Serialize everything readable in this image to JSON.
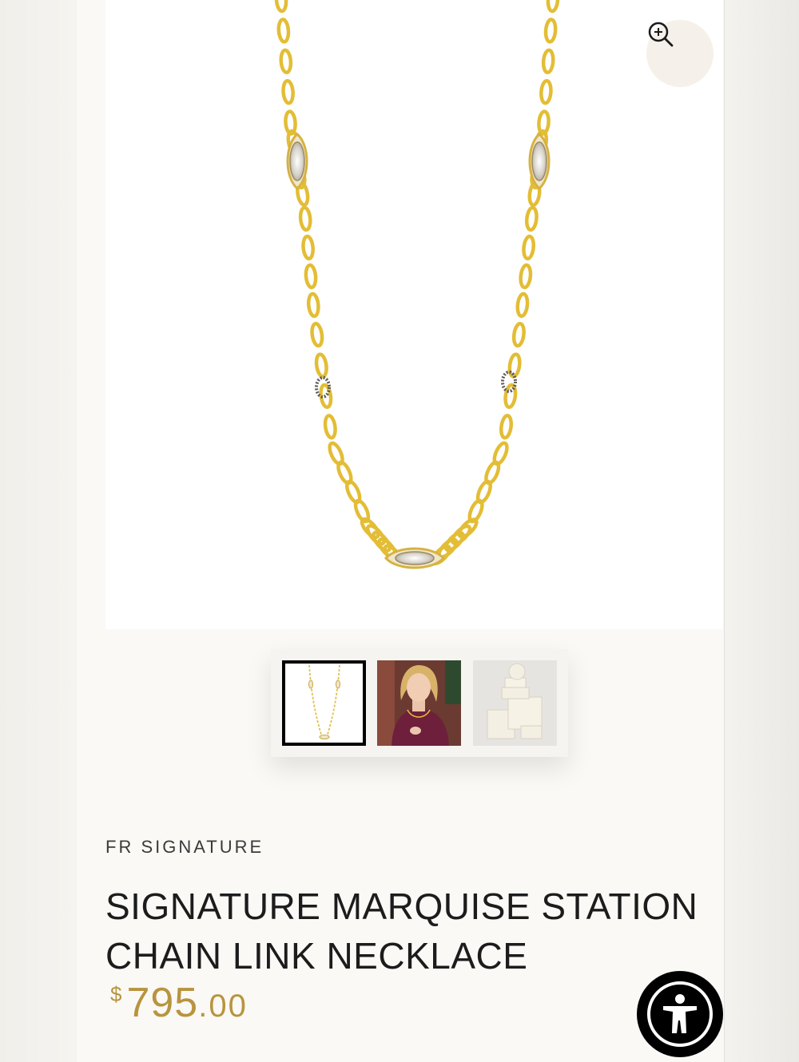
{
  "product": {
    "brand": "FR SIGNATURE",
    "title_line1": "SIGNATURE MARQUISE STATION",
    "title_line2": "CHAIN LINK NECKLACE",
    "price_currency": "$",
    "price_whole": "795",
    "price_cents": ".00"
  },
  "gallery": {
    "thumbnails": [
      "necklace-product-photo",
      "model-wearing-necklace",
      "packaging-boxes"
    ],
    "selected_index": 0
  },
  "icons": {
    "zoom": "zoom-in-icon",
    "accessibility": "accessibility-icon"
  },
  "colors": {
    "gold": "#b8943e",
    "chain": "#e8c23a",
    "text": "#1c1c1c"
  }
}
